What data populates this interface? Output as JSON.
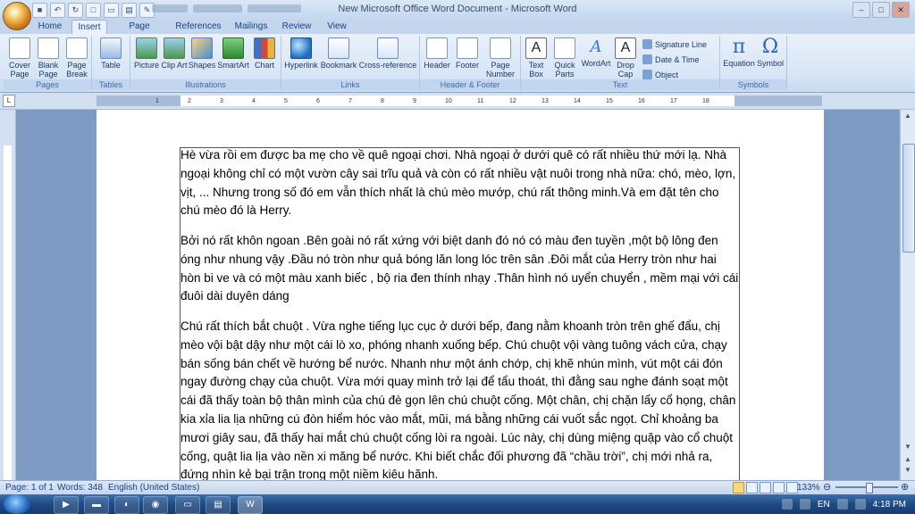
{
  "window": {
    "title": "New Microsoft Office Word Document - Microsoft Word",
    "controls": [
      "–",
      "□",
      "✕"
    ]
  },
  "tabs": [
    "Home",
    "Insert",
    "Page Layout",
    "References",
    "Mailings",
    "Review",
    "View"
  ],
  "active_tab": "Insert",
  "ribbon": {
    "pages": {
      "label": "Pages",
      "cover": "Cover Page",
      "blank": "Blank Page",
      "break": "Page Break"
    },
    "tables": {
      "label": "Tables",
      "table": "Table"
    },
    "illustrations": {
      "label": "Illustrations",
      "picture": "Picture",
      "clipart": "Clip Art",
      "shapes": "Shapes",
      "smartart": "SmartArt",
      "chart": "Chart"
    },
    "links": {
      "label": "Links",
      "hyperlink": "Hyperlink",
      "bookmark": "Bookmark",
      "crossref": "Cross-reference"
    },
    "header_footer": {
      "label": "Header & Footer",
      "header": "Header",
      "footer": "Footer",
      "pagenumber": "Page Number"
    },
    "text": {
      "label": "Text",
      "textbox": "Text Box",
      "quickparts": "Quick Parts",
      "wordart": "WordArt",
      "dropcap": "Drop Cap",
      "signature": "Signature Line",
      "datetime": "Date & Time",
      "object": "Object"
    },
    "symbols": {
      "label": "Symbols",
      "equation": "Equation",
      "symbol": "Symbol"
    }
  },
  "ruler": {
    "ticks": [
      "1",
      "2",
      "3",
      "4",
      "5",
      "6",
      "7",
      "8",
      "9",
      "10",
      "11",
      "12",
      "13",
      "14",
      "15",
      "16",
      "17",
      "18"
    ]
  },
  "document": {
    "paragraphs": [
      "Hè vừa rồi em được ba mẹ cho về quê ngoại chơi. Nhà ngoại ở dưới quê có rất nhiều thứ mới lạ. Nhà ngoại không chỉ có một vườn cây sai trĩu quả và còn có rất nhiều vật nuôi trong nhà nữa: chó, mèo, lợn, vịt, ... Nhưng trong số đó em vẫn thích nhất là chú mèo mướp, chú rất thông minh.Và em đặt tên cho chú mèo đó là Herry.",
      "Bởi nó rất khôn ngoan .Bên goài nó rất xứng với biệt danh đó nó có màu đen tuyền ,một bộ lông đen óng như nhung vậy .Đầu nó tròn  như quả bóng lăn long lóc trên sân .Đôi mắt của Herry tròn như hai hòn bi ve và có một màu xanh biếc , bộ ria đen thính nhạy .Thân hình nó uyển chuyển , mềm mại với cái đuôi dài duyên dáng",
      "Chú rất thích bắt chuột .  Vừa nghe tiếng lục cục ở dưới bếp, đang nằm khoanh tròn trên ghế đẩu, chị mèo vội bật dậy như một cái lò xo, phóng nhanh xuống bếp. Chú chuột vội vàng tuông vách cửa, chạy bán sống bán chết về hướng bể nước. Nhanh như một ánh chớp, chị khẽ nhún mình, vút một cái đón ngay đường chạy của chuột. Vừa mới quay mình trở lại để tẩu thoát, thì đằng sau nghe đánh soạt một cái đã thấy toàn bộ thân mình của chú đè gọn lên chú chuột cống. Một chân, chị chặn lấy cổ họng, chân kia xỉa lia lịa những cú đòn hiểm hóc vào mắt, mũi, má bằng những cái vuốt sắc ngọt. Chỉ khoảng ba mươi giây sau, đã thấy hai mắt chú chuột cống lòi ra ngoài. Lúc này, chị dùng miệng quặp vào cổ chuột cống, quật lia lịa vào nền xi măng bể nước. Khi biết chắc đối phương đã “chầu trời”, chị mới nhả ra, đứng nhìn kẻ bại trận trong một niềm kiêu hãnh."
    ]
  },
  "status": {
    "page": "Page: 1 of 1",
    "words": "Words: 348",
    "language": "English (United States)",
    "zoom": "133%"
  },
  "taskbar": {
    "lang": "EN",
    "time": "4:18 PM"
  }
}
